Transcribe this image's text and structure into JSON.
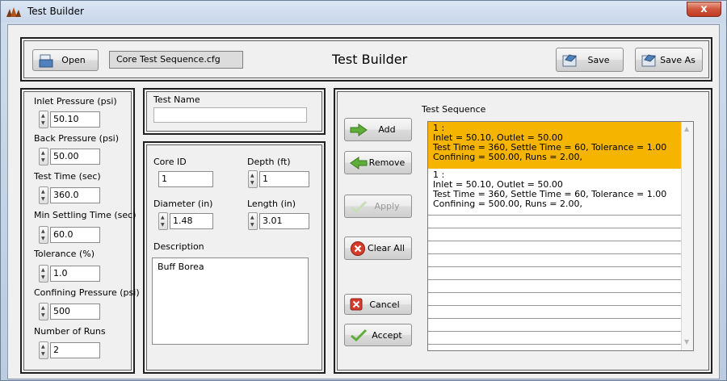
{
  "window": {
    "title": "Test Builder",
    "close_glyph": "x"
  },
  "toolbar": {
    "open_label": "Open",
    "config_file": "Core Test Sequence.cfg",
    "heading": "Test Builder",
    "save_label": "Save",
    "save_as_label": "Save As"
  },
  "params": {
    "inlet_label": "Inlet Pressure (psi)",
    "inlet_value": "50.10",
    "back_label": "Back Pressure (psi)",
    "back_value": "50.00",
    "test_time_label": "Test Time (sec)",
    "test_time_value": "360.0",
    "settling_label": "Min Settling Time (sec)",
    "settling_value": "60.0",
    "tolerance_label": "Tolerance (%)",
    "tolerance_value": "1.0",
    "confining_label": "Confining Pressure (psi)",
    "confining_value": "500",
    "runs_label": "Number of Runs",
    "runs_value": "2"
  },
  "test_name": {
    "label": "Test Name",
    "value": ""
  },
  "core": {
    "core_id_label": "Core ID",
    "core_id_value": "1",
    "depth_label": "Depth (ft)",
    "depth_value": "1",
    "diameter_label": "Diameter (in)",
    "diameter_value": "1.48",
    "length_label": "Length (in)",
    "length_value": "3.01",
    "description_label": "Description",
    "description_value": "Buff Borea"
  },
  "actions": {
    "add": "Add",
    "remove": "Remove",
    "apply": "Apply",
    "clear_all": "Clear All",
    "cancel": "Cancel",
    "accept": "Accept"
  },
  "sequence": {
    "label": "Test Sequence",
    "items": [
      {
        "index": "1 :",
        "line1": "Inlet = 50.10, Outlet = 50.00",
        "line2": "Test Time = 360, Settle Time = 60, Tolerance = 1.00",
        "line3": "Confining = 500.00, Runs = 2.00,"
      },
      {
        "index": "1 :",
        "line1": "Inlet = 50.10, Outlet = 50.00",
        "line2": "Test Time = 360, Settle Time = 60, Tolerance = 1.00",
        "line3": "Confining = 500.00, Runs = 2.00,"
      }
    ]
  },
  "colors": {
    "selected_row": "#f5b400",
    "accent_blue": "#4f81bd",
    "close_red": "#c8452c"
  }
}
